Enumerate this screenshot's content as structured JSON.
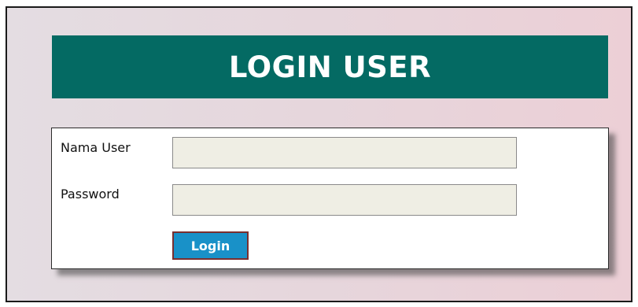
{
  "header": {
    "title": "LOGIN USER"
  },
  "form": {
    "username": {
      "label": "Nama User",
      "value": "",
      "placeholder": ""
    },
    "password": {
      "label": "Password",
      "value": "",
      "placeholder": ""
    },
    "submit_label": "Login"
  },
  "colors": {
    "banner": "#046a63",
    "button": "#1991c8",
    "input_background": "#efeee4"
  }
}
